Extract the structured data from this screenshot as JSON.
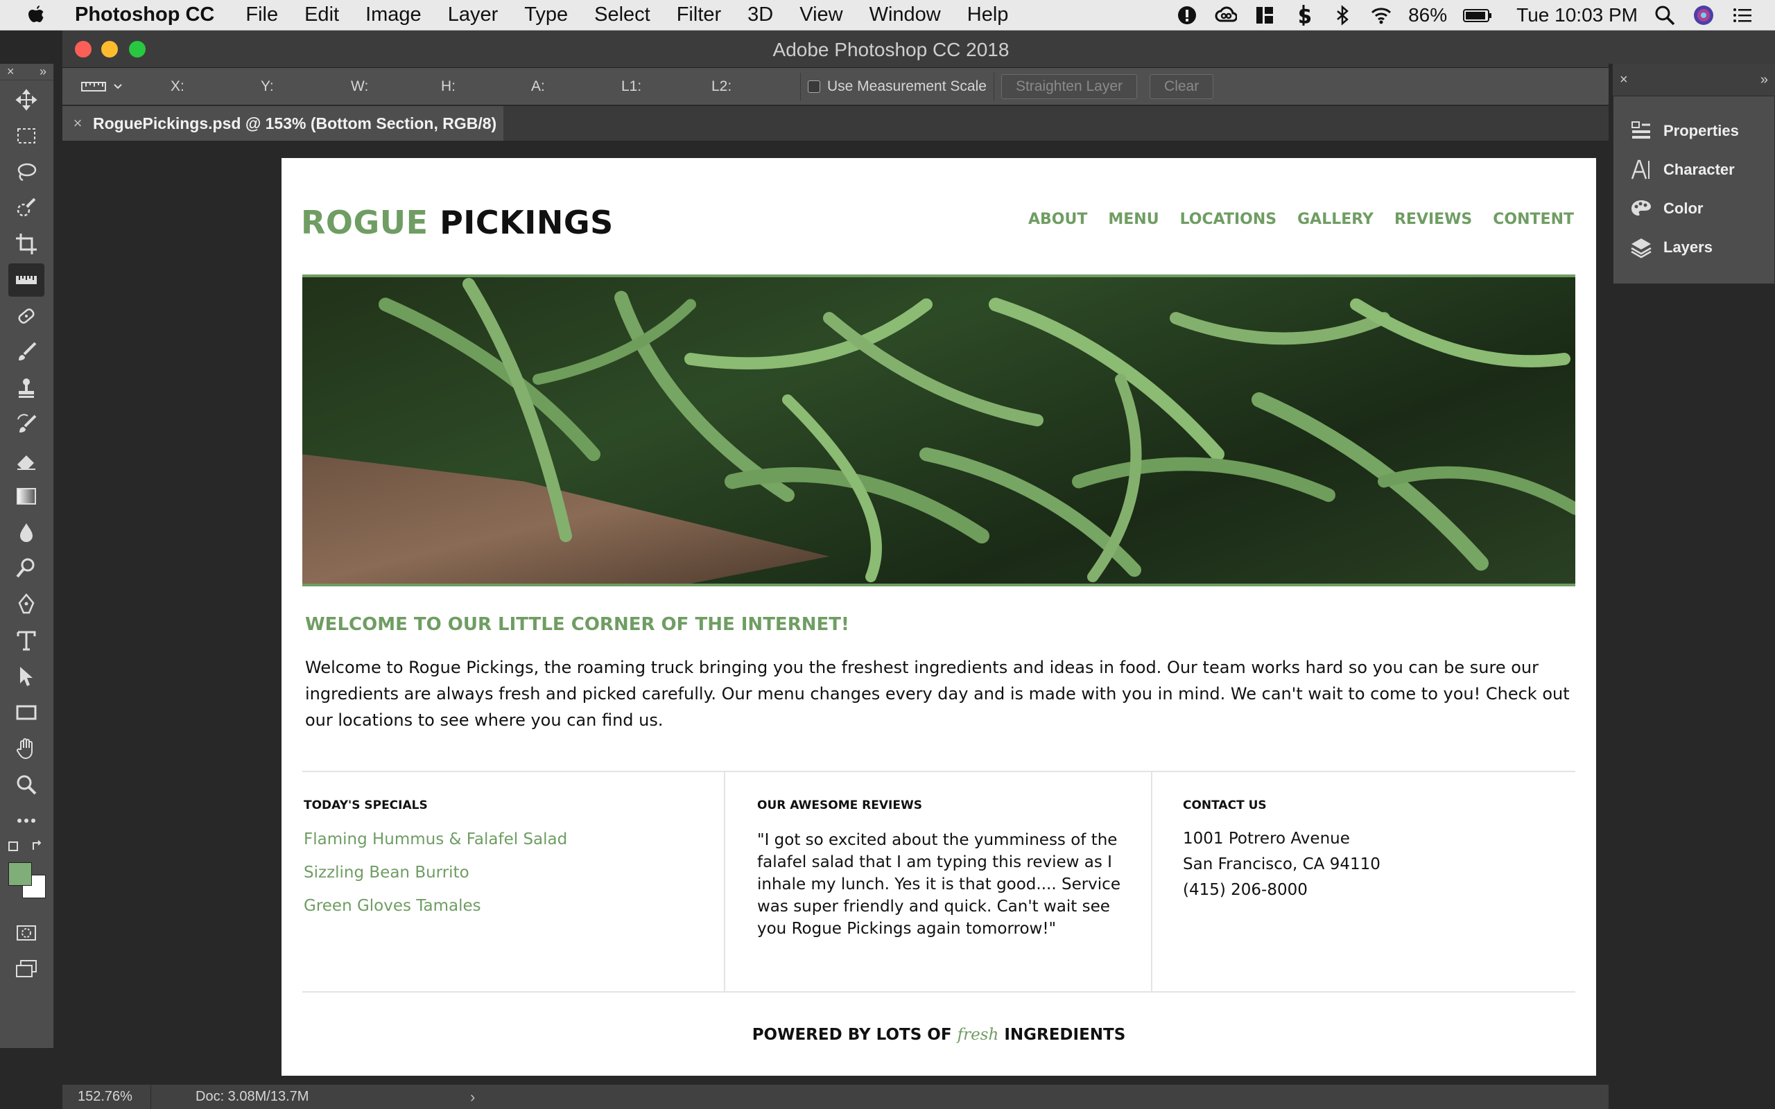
{
  "menubar": {
    "app_name": "Photoshop CC",
    "items": [
      "File",
      "Edit",
      "Image",
      "Layer",
      "Type",
      "Select",
      "Filter",
      "3D",
      "View",
      "Window",
      "Help"
    ],
    "battery": "86%",
    "clock": "Tue 10:03 PM"
  },
  "window": {
    "title": "Adobe Photoshop CC 2018"
  },
  "options": {
    "x_label": "X:",
    "y_label": "Y:",
    "w_label": "W:",
    "h_label": "H:",
    "a_label": "A:",
    "l1_label": "L1:",
    "l2_label": "L2:",
    "measurement_scale": "Use Measurement Scale",
    "straighten": "Straighten Layer",
    "clear": "Clear"
  },
  "doc_tab": {
    "close": "×",
    "title": "RoguePickings.psd @ 153% (Bottom Section, RGB/8)"
  },
  "statusbar": {
    "zoom": "152.76%",
    "doc": "Doc: 3.08M/13.7M",
    "arrow": "›"
  },
  "right_panel": {
    "close": "×",
    "collapse": "»",
    "items": [
      {
        "label": "Properties",
        "icon": "properties-icon"
      },
      {
        "label": "Character",
        "icon": "character-icon"
      },
      {
        "label": "Color",
        "icon": "color-palette-icon"
      },
      {
        "label": "Layers",
        "icon": "layers-icon"
      }
    ]
  },
  "tools_panel": {
    "close": "×",
    "collapse": "»"
  },
  "colors": {
    "foreground": "#7fae78",
    "background": "#ffffff",
    "brand_green": "#6f9d63"
  },
  "page": {
    "logo_green": "ROGUE",
    "logo_dark": "PICKINGS",
    "nav": [
      "ABOUT",
      "MENU",
      "LOCATIONS",
      "GALLERY",
      "REVIEWS",
      "CONTENT"
    ],
    "welcome_heading": "WELCOME TO OUR LITTLE CORNER OF THE INTERNET!",
    "welcome_text": "Welcome to Rogue Pickings, the roaming truck bringing you the freshest ingredients and ideas in food. Our team works hard so you can be sure our ingredients are always fresh and picked carefully. Our menu changes every day and is made with you in mind. We can't wait to come to you! Check out our locations to see where you can find us.",
    "specials_heading": "TODAY'S SPECIALS",
    "specials": [
      "Flaming Hummus & Falafel Salad",
      "Sizzling Bean Burrito",
      "Green Gloves Tamales"
    ],
    "reviews_heading": "OUR AWESOME REVIEWS",
    "review": "\"I got so excited about the yumminess of the falafel salad that I am typing this review as I inhale my lunch. Yes it is that good.... Service was super friendly and quick. Can't wait see you Rogue Pickings again tomorrow!\"",
    "contact_heading": "CONTACT US",
    "contact_lines": [
      "1001 Potrero Avenue",
      "San Francisco, CA 94110",
      "(415) 206-8000"
    ],
    "footer_before": "POWERED BY LOTS OF",
    "footer_fresh": "fresh",
    "footer_after": "INGREDIENTS"
  }
}
